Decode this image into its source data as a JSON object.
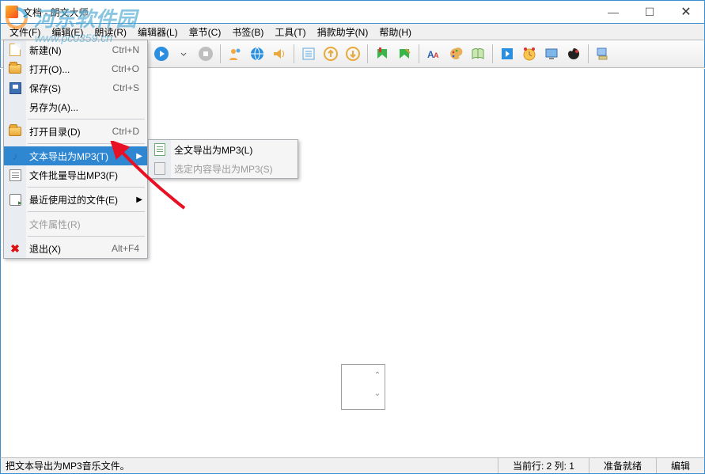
{
  "watermark": {
    "text": "河东软件园",
    "url": "www.pc0359.cn"
  },
  "title": "文档 - 朗文大师",
  "sys": {
    "min": "—",
    "max": "☐",
    "close": "✕"
  },
  "menubar": [
    "文件(F)",
    "编辑(E)",
    "朗读(R)",
    "编辑器(L)",
    "章节(C)",
    "书签(B)",
    "工具(T)",
    "捐款助学(N)",
    "帮助(H)"
  ],
  "file_menu": [
    {
      "label": "新建(N)",
      "shortcut": "Ctrl+N",
      "icon": "ic-new"
    },
    {
      "label": "打开(O)...",
      "shortcut": "Ctrl+O",
      "icon": "ic-open"
    },
    {
      "label": "保存(S)",
      "shortcut": "Ctrl+S",
      "icon": "ic-save"
    },
    {
      "label": "另存为(A)...",
      "shortcut": "",
      "icon": ""
    },
    {
      "sep": true
    },
    {
      "label": "打开目录(D)",
      "shortcut": "Ctrl+D",
      "icon": "ic-open"
    },
    {
      "sep": true
    },
    {
      "label": "文本导出为MP3(T)",
      "shortcut": "",
      "icon": "ic-music",
      "arrow": true,
      "highlight": true
    },
    {
      "label": "文件批量导出MP3(F)",
      "shortcut": "",
      "icon": "ic-batch"
    },
    {
      "sep": true
    },
    {
      "label": "最近使用过的文件(E)",
      "shortcut": "",
      "icon": "ic-recent",
      "arrow": true
    },
    {
      "sep": true
    },
    {
      "label": "文件属性(R)",
      "shortcut": "",
      "icon": "",
      "disabled": true
    },
    {
      "sep": true
    },
    {
      "label": "退出(X)",
      "shortcut": "Alt+F4",
      "icon": "ic-exit"
    }
  ],
  "sub_menu": [
    {
      "label": "全文导出为MP3(L)",
      "icon": "ic-doc"
    },
    {
      "label": "选定内容导出为MP3(S)",
      "icon": "ic-sel",
      "disabled": true
    }
  ],
  "status": {
    "hint": "把文本导出为MP3音乐文件。",
    "pos": "当前行: 2  列: 1",
    "ready": "准备就绪",
    "mode": "编辑"
  }
}
